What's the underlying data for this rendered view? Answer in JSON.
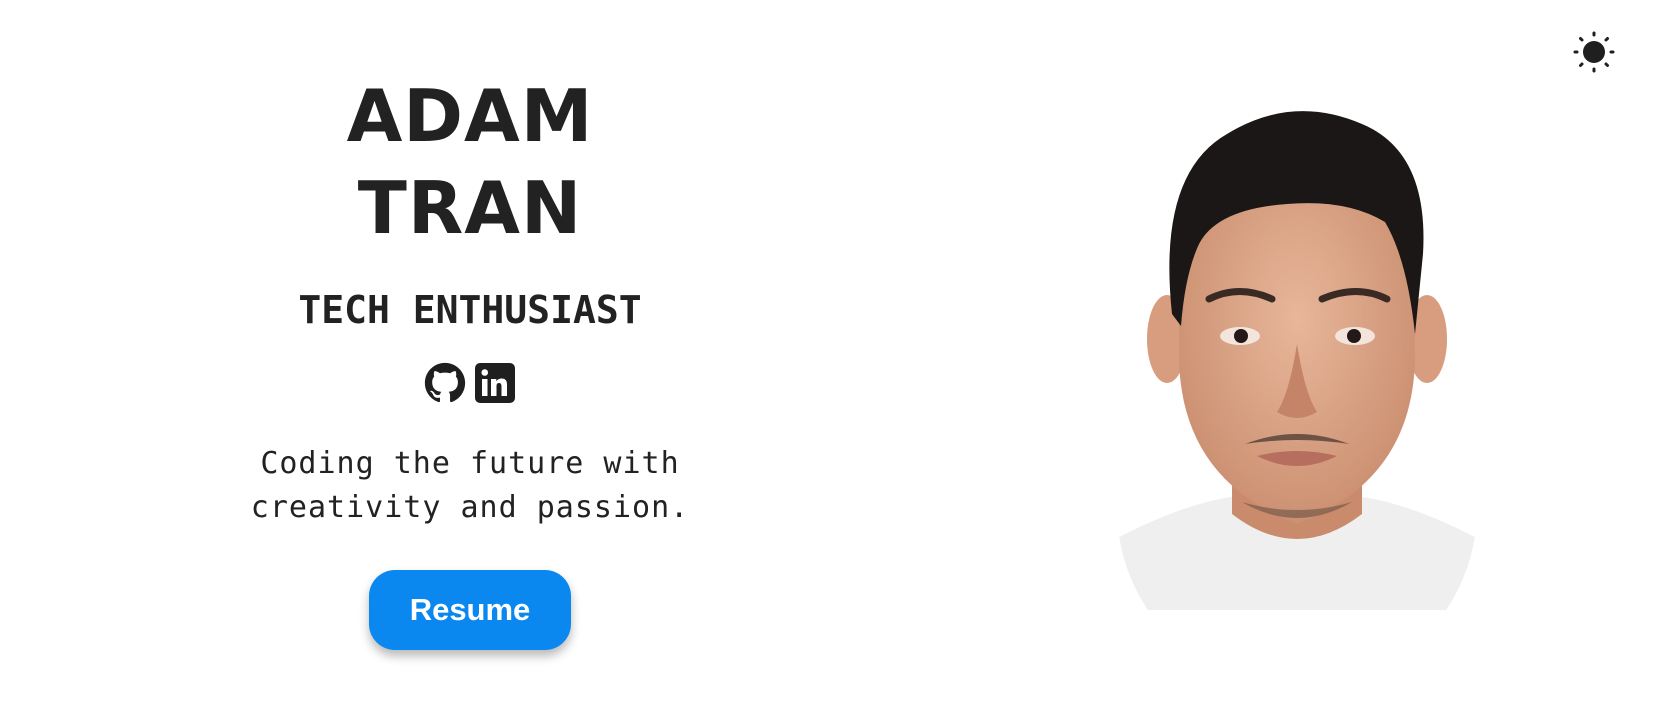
{
  "theme_toggle": {
    "icon": "sun-icon"
  },
  "hero": {
    "name_line1": "ADAM",
    "name_line2": "TRAN",
    "role": "TECH ENTHUSIAST",
    "socials": [
      {
        "name": "GitHub",
        "icon": "github-icon"
      },
      {
        "name": "LinkedIn",
        "icon": "linkedin-icon"
      }
    ],
    "tagline": "Coding the future with\ncreativity and passion.",
    "resume_label": "Resume"
  },
  "colors": {
    "text": "#222222",
    "accent": "#0a88f0",
    "background": "#ffffff"
  }
}
